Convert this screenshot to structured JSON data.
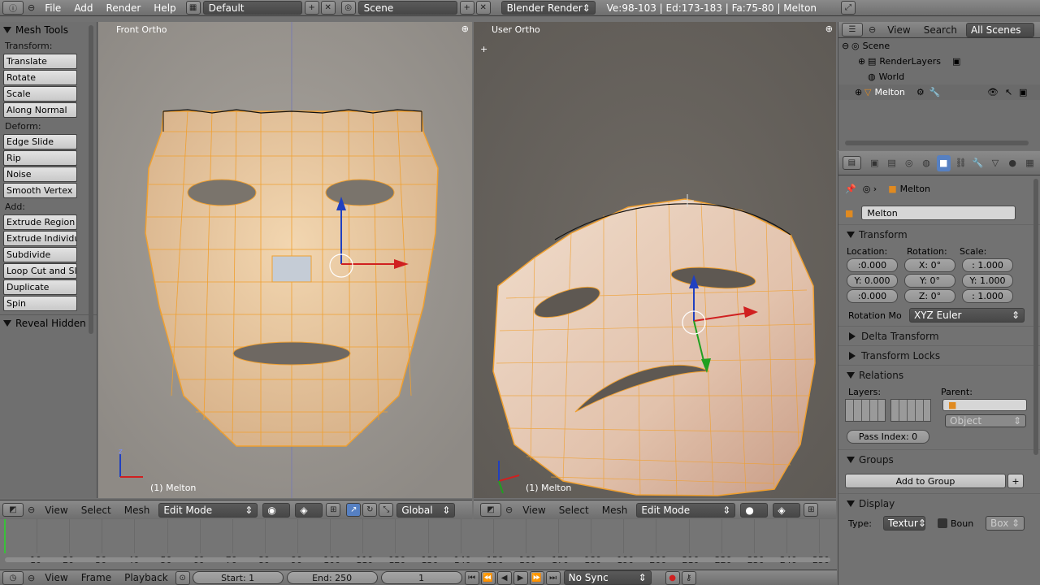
{
  "topbar": {
    "menus": [
      "File",
      "Add",
      "Render",
      "Help"
    ],
    "screen_layout": "Default",
    "scene": "Scene",
    "render_engine": "Blender Render",
    "stats": "Ve:98-103 | Ed:173-183 | Fa:75-80 | Melton"
  },
  "toolshelf": {
    "title": "Mesh Tools",
    "sections": [
      {
        "label": "Transform:",
        "buttons": [
          "Translate",
          "Rotate",
          "Scale",
          "Along Normal"
        ]
      },
      {
        "label": "Deform:",
        "buttons": [
          "Edge Slide",
          "Rip",
          "Noise",
          "Smooth Vertex"
        ]
      },
      {
        "label": "Add:",
        "buttons": [
          "Extrude Region",
          "Extrude Individual",
          "Subdivide",
          "Loop Cut and Slide",
          "Duplicate",
          "Spin"
        ]
      }
    ],
    "panel2": "Reveal Hidden"
  },
  "viewport_left": {
    "label": "Front Ortho",
    "object_label": "(1) Melton",
    "axis_z": "z"
  },
  "viewport_right": {
    "label": "User Ortho",
    "object_label": "(1) Melton"
  },
  "header_left": {
    "menus": [
      "View",
      "Select",
      "Mesh"
    ],
    "mode": "Edit Mode",
    "orientation": "Global"
  },
  "header_right": {
    "menus": [
      "View",
      "Select",
      "Mesh"
    ],
    "mode": "Edit Mode"
  },
  "timeline": {
    "ticks": [
      "10",
      "20",
      "30",
      "40",
      "50",
      "60",
      "70",
      "80",
      "90",
      "100",
      "110",
      "120",
      "130",
      "140",
      "150",
      "160",
      "170",
      "180",
      "190",
      "200",
      "210",
      "220",
      "230",
      "240",
      "250"
    ]
  },
  "bottombar": {
    "menus": [
      "View",
      "Frame",
      "Playback"
    ],
    "start": "Start: 1",
    "end": "End: 250",
    "current": "1",
    "sync": "No Sync"
  },
  "outliner": {
    "menus": [
      "View",
      "Search"
    ],
    "filter": "All Scenes",
    "items": [
      "Scene",
      "RenderLayers",
      "World",
      "Melton"
    ]
  },
  "properties": {
    "breadcrumb_object": "Melton",
    "object_name": "Melton",
    "transform": {
      "title": "Transform",
      "location_label": "Location:",
      "rotation_label": "Rotation:",
      "scale_label": "Scale:",
      "location": [
        ":0.000",
        "Y: 0.000",
        ":0.000"
      ],
      "rotation": [
        "X: 0°",
        "Y: 0°",
        "Z: 0°"
      ],
      "scale": [
        ": 1.000",
        "Y: 1.000",
        ": 1.000"
      ],
      "rotation_mode_label": "Rotation Mo",
      "rotation_mode": "XYZ Euler"
    },
    "collapsed": [
      "Delta Transform",
      "Transform Locks"
    ],
    "relations": {
      "title": "Relations",
      "layers_label": "Layers:",
      "parent_label": "Parent:",
      "parent_type": "Object",
      "pass_index": "Pass Index: 0"
    },
    "groups": {
      "title": "Groups",
      "add_button": "Add to Group"
    },
    "display": {
      "title": "Display",
      "type_label": "Type:",
      "type_value": "Textur",
      "bounds_label": "Boun",
      "bounds_value": "Box"
    }
  }
}
